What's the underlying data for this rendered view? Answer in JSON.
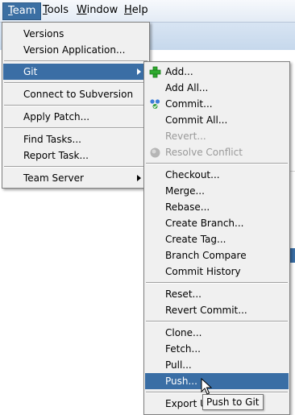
{
  "menubar": {
    "items": [
      {
        "label": "Team",
        "mnemonic": "T"
      },
      {
        "label": "Tools",
        "mnemonic": "T"
      },
      {
        "label": "Window",
        "mnemonic": "W"
      },
      {
        "label": "Help",
        "mnemonic": "H"
      }
    ],
    "active": "Team"
  },
  "team_menu": {
    "items": {
      "versions": "Versions",
      "version_application": "Version Application...",
      "git": "Git",
      "connect_svn": "Connect to Subversion",
      "apply_patch": "Apply Patch...",
      "find_tasks": "Find Tasks...",
      "report_task": "Report Task...",
      "team_server": "Team Server"
    }
  },
  "git_menu": {
    "items": {
      "add": "Add...",
      "add_all": "Add All...",
      "commit": "Commit...",
      "commit_all": "Commit All...",
      "revert": "Revert...",
      "resolve_conflict": "Resolve Conflict",
      "checkout": "Checkout...",
      "merge": "Merge...",
      "rebase": "Rebase...",
      "create_branch": "Create Branch...",
      "create_tag": "Create Tag...",
      "branch_compare": "Branch Compare",
      "commit_history": "Commit History",
      "reset": "Reset...",
      "revert_commit": "Revert Commit...",
      "clone": "Clone...",
      "fetch": "Fetch...",
      "pull": "Pull...",
      "push": "Push...",
      "export": "Export U"
    },
    "selected": "Push..."
  },
  "tooltip": {
    "text": "Push to Git"
  },
  "colors": {
    "selection": "#3a6ea5",
    "menu_bg": "#f0f0f0",
    "menubar_active": "#3b6fa3"
  }
}
